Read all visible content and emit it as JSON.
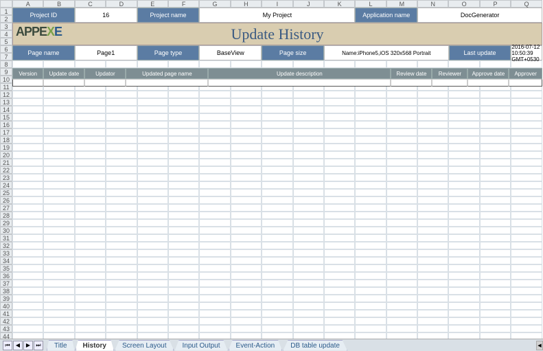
{
  "columns": [
    "A",
    "B",
    "C",
    "D",
    "E",
    "F",
    "G",
    "H",
    "I",
    "J",
    "K",
    "L",
    "M",
    "N",
    "O",
    "P",
    "Q"
  ],
  "row_count": 44,
  "header1": {
    "project_id_label": "Project ID",
    "project_id_value": "16",
    "project_name_label": "Project name",
    "project_name_value": "My Project",
    "app_name_label": "Application name",
    "app_name_value": "DocGenerator"
  },
  "banner": {
    "logo_text": "APPE",
    "logo_x": "X",
    "logo_e": "E",
    "title": "Update History"
  },
  "header2": {
    "page_name_label": "Page name",
    "page_name_value": "Page1",
    "page_type_label": "Page type",
    "page_type_value": "BaseView",
    "page_size_label": "Page size",
    "page_size_value": "Name:iPhone5,iOS 320x568 Portrait",
    "last_update_label": "Last update",
    "last_update_value": "2016-07-12 10:50:39 GMT+0530"
  },
  "table_headers": {
    "version": "Version",
    "update_date": "Update date",
    "updator": "Updator",
    "updated_page": "Updated page name",
    "update_desc": "Update description",
    "review_date": "Review date",
    "reviewer": "Reviewer",
    "approve_date": "Approve date",
    "approver": "Approver"
  },
  "tabs": {
    "items": [
      "Title",
      "History",
      "Screen Layout",
      "Input Output",
      "Event-Action",
      "DB table update"
    ],
    "active_index": 1
  }
}
